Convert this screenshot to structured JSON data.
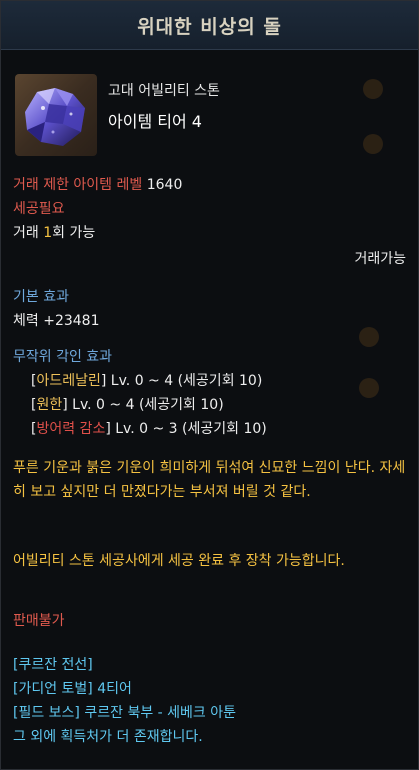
{
  "title": "위대한 비상의 돌",
  "item": {
    "kind": "고대 어빌리티 스톤",
    "tier": "아이템 티어 4",
    "icon": "amethyst-crystal-icon"
  },
  "trade": {
    "level_label": "거래 제한 아이템 레벨",
    "level_value": "1640",
    "need_cut": "세공필요",
    "count_prefix": "거래",
    "count_value": "1",
    "count_suffix": "회 가능",
    "tradable": "거래가능"
  },
  "base_effect": {
    "heading": "기본 효과",
    "stat": "체력 +23481"
  },
  "engrave": {
    "heading": "무작위 각인 효과",
    "lines": [
      {
        "name": "아드레날린",
        "range": " Lv. 0 ~ 4 (세공기회 10)",
        "negative": false
      },
      {
        "name": "원한",
        "range": " Lv. 0 ~ 4 (세공기회 10)",
        "negative": false
      },
      {
        "name": "방어력 감소",
        "range": " Lv. 0 ~ 3 (세공기회 10)",
        "negative": true
      }
    ]
  },
  "description": "푸른 기운과 붉은 기운이 희미하게 뒤섞여 신묘한 느낌이 난다. 자세히 보고 싶지만 더 만졌다가는 부서져 버릴 것 같다.",
  "usage": "어빌리티 스톤 세공사에게 세공 완료 후 장착 가능합니다.",
  "sell": "판매불가",
  "sources": [
    {
      "bracket": "[쿠르잔 전선]",
      "text": ""
    },
    {
      "bracket": "[가디언 토벌]",
      "text": " 4티어"
    },
    {
      "bracket": "[필드 보스]",
      "text": " 쿠르잔 북부 - 세베크 아툰"
    }
  ],
  "sources_more": "그 외에 획득처가 더 존재합니다.",
  "colors": {
    "red": "#e05a4e",
    "gold": "#f5c242",
    "blue": "#6fa8dc",
    "cyan": "#5fc8f0"
  }
}
